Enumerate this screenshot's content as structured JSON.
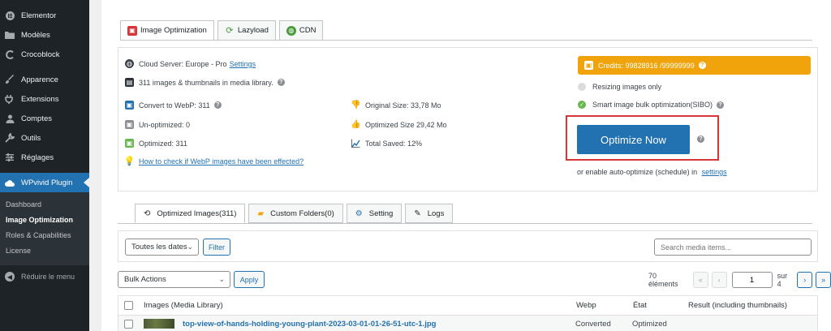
{
  "sidebar": {
    "items": [
      {
        "label": "Elementor",
        "icon": "elementor-icon"
      },
      {
        "label": "Modèles",
        "icon": "folder-icon"
      },
      {
        "label": "Crocoblock",
        "icon": "crocoblock-icon"
      },
      {
        "label": "Apparence",
        "icon": "brush-icon"
      },
      {
        "label": "Extensions",
        "icon": "plugin-icon"
      },
      {
        "label": "Comptes",
        "icon": "user-icon"
      },
      {
        "label": "Outils",
        "icon": "wrench-icon"
      },
      {
        "label": "Réglages",
        "icon": "settings-icon"
      }
    ],
    "active": {
      "label": "WPvivid Plugin",
      "icon": "cloud-icon"
    },
    "submenu": [
      "Dashboard",
      "Image Optimization",
      "Roles & Capabilities",
      "License"
    ],
    "collapse_label": "Réduire le menu"
  },
  "top_tabs": [
    "Image Optimization",
    "Lazyload",
    "CDN"
  ],
  "info": {
    "cloud_server": "Cloud Server: Europe - Pro",
    "settings_link": "Settings",
    "media_count": "311 images & thumbnails in media library.",
    "webp": "Convert to WebP: 311",
    "unoptimized": "Un-optimized: 0",
    "optimized": "Optimized: 311",
    "original_size": "Original Size: 33,78 Mo",
    "optimized_size": "Optimized Size 29,42 Mo",
    "total_saved": "Total Saved: 12%",
    "webp_check_link": "How to check if WebP images have been effected?"
  },
  "credits": "Credits: 99828916 /99999999",
  "options": {
    "resizing": "Resizing images only",
    "smart": "Smart image bulk optimization(SIBO)"
  },
  "optimize_button": "Optimize Now",
  "schedule": {
    "text": "or enable auto-optimize (schedule) in",
    "link": "settings"
  },
  "lower_tabs": [
    "Optimized Images(311)",
    "Custom Folders(0)",
    "Setting",
    "Logs"
  ],
  "filter": {
    "date_select": "Toutes les dates",
    "filter_button": "Filter",
    "search_placeholder": "Search media items..."
  },
  "bulk": {
    "select": "Bulk Actions",
    "apply": "Apply"
  },
  "pagination": {
    "count": "70 éléments",
    "first": "«",
    "prev": "‹",
    "current": "1",
    "of": "sur 4",
    "next": "›",
    "last": "»"
  },
  "table": {
    "headers": [
      "Images (Media Library)",
      "Webp",
      "État",
      "Result (including thumbnails)"
    ],
    "rows": [
      {
        "name": "top-view-of-hands-holding-young-plant-2023-03-01-01-26-51-utc-1.jpg",
        "webp": "Converted",
        "state": "Optimized"
      }
    ]
  },
  "colors": {
    "accent": "#2271b1",
    "credits_bg": "#f0a30a",
    "highlight": "#d63638",
    "sidebar_bg": "#1d2327"
  }
}
